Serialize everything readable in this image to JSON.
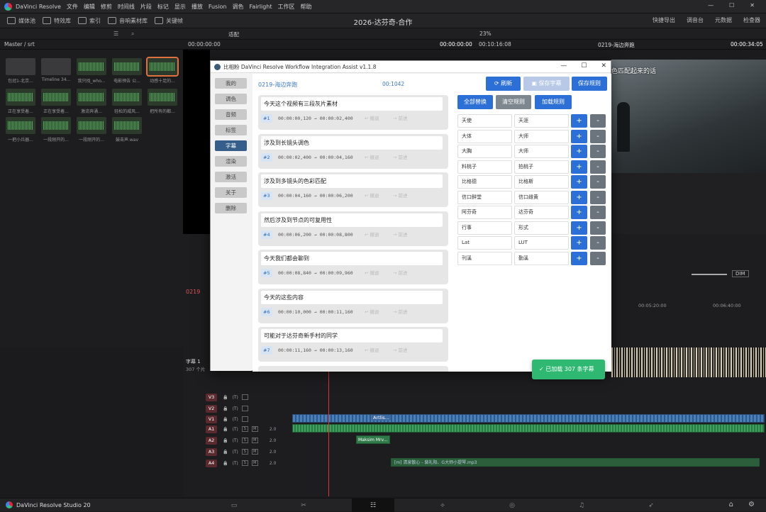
{
  "app": {
    "title": "DaVinci Resolve",
    "menu": [
      "文件",
      "编辑",
      "修剪",
      "时间线",
      "片段",
      "标记",
      "显示",
      "播放",
      "Fusion",
      "调色",
      "Fairlight",
      "工作区",
      "帮助"
    ]
  },
  "toolbar": {
    "media_pool": "媒体池",
    "effects": "特效库",
    "index": "索引",
    "sound_library": "音响素材库",
    "keyframes": "关键帧",
    "project_title": "2026-达芬奇-合作",
    "quick_export": "快捷导出",
    "mixer": "调音台",
    "metadata": "元数据",
    "inspector": "检查器"
  },
  "row3": {
    "fit": "适配",
    "zoom": "23%"
  },
  "row4": {
    "breadcrumb": "Master / srt",
    "tc_left": "00:00:00:00",
    "tc_mid": "00:00:00:00",
    "tc_right_a": "00:10:16:08",
    "timeline_name": "0219-海边奔跑",
    "tc_right_b": "00:00:34:05"
  },
  "mediapool": {
    "clips": [
      {
        "label": "包冠1-北京...",
        "type": "img"
      },
      {
        "label": "Timeline 34...",
        "type": "img"
      },
      {
        "label": "我只找_who...",
        "type": "wave"
      },
      {
        "label": "电影预告 公...",
        "type": "wave"
      },
      {
        "label": "动感十足的...",
        "type": "wave",
        "selected": true
      },
      {
        "label": "正在享受着...",
        "type": "wave"
      },
      {
        "label": "正在享受着...",
        "type": "wave"
      },
      {
        "label": "激流奔涌...",
        "type": "wave"
      },
      {
        "label": "轻松的威风...",
        "type": "wave"
      },
      {
        "label": "把所有的都...",
        "type": "wave"
      },
      {
        "label": "一把小兵器...",
        "type": "wave"
      },
      {
        "label": "一段刚开的...",
        "type": "wave"
      },
      {
        "label": "一段刚开的...",
        "type": "wave"
      },
      {
        "label": "鼓击声.wav",
        "type": "wave"
      }
    ]
  },
  "viewer": {
    "subtitle": "色匹配起来的话"
  },
  "plugin": {
    "title": "比相粉 DaVinci Resolve Workflow Integration Assist v1.1.8",
    "nav": [
      "我的",
      "调色",
      "音频",
      "标签",
      "字幕",
      "渲染",
      "激活",
      "关于",
      "删除"
    ],
    "active_nav": "字幕",
    "timeline_name": "0219-海边奔跑",
    "duration": "00:1042",
    "buttons": {
      "refresh": "刷新",
      "save_subtitle": "保存字幕",
      "save_rules": "保存规则",
      "replace_all": "全部替换",
      "clear_rules": "清空规则",
      "load_rules": "加载规则"
    },
    "subtitles": [
      {
        "text": "今天这个视频有三段灰片素材",
        "num": "#1",
        "time": "00:00:00,120 → 00:00:02,400",
        "act1": "↩ 撤退",
        "act2": "→ 前进"
      },
      {
        "text": "涉及到长镜头调色",
        "num": "#2",
        "time": "00:00:02,400 → 00:00:04,160",
        "act1": "↩ 撤退",
        "act2": "→ 前进"
      },
      {
        "text": "涉及到多镜头的色彩匹配",
        "num": "#3",
        "time": "00:00:04,160 → 00:00:06,200",
        "act1": "↩ 撤退",
        "act2": "→ 前进"
      },
      {
        "text": "然后涉及到节点的可复用性",
        "num": "#4",
        "time": "00:00:06,200 → 00:00:08,800",
        "act1": "↩ 撤退",
        "act2": "→ 前进"
      },
      {
        "text": "今天我们都会聊到",
        "num": "#5",
        "time": "00:00:08,840 → 00:00:09,960",
        "act1": "↩ 撤退",
        "act2": "→ 前进"
      },
      {
        "text": "今天的这些内容",
        "num": "#6",
        "time": "00:00:10,000 → 00:00:11,160",
        "act1": "↩ 撤退",
        "act2": "→ 前进"
      },
      {
        "text": "可能对于达芬奇新手村的同学",
        "num": "#7",
        "time": "00:00:11,160 → 00:00:13,160",
        "act1": "↩ 撤退",
        "act2": "→ 前进"
      }
    ],
    "rules": [
      {
        "from": "天使",
        "to": "天涯"
      },
      {
        "from": "大体",
        "to": "大师"
      },
      {
        "from": "大胸",
        "to": "大师"
      },
      {
        "from": "料桃子",
        "to": "拍桃子"
      },
      {
        "from": "比格德",
        "to": "比格斯"
      },
      {
        "from": "信口鲜堂",
        "to": "信口雌黄"
      },
      {
        "from": "阿芬奇",
        "to": "达芬奇"
      },
      {
        "from": "行事",
        "to": "形式"
      },
      {
        "from": "Lat",
        "to": "LUT"
      },
      {
        "from": "刊溪",
        "to": "勤溪"
      }
    ],
    "plus": "+",
    "minus": "-",
    "toast": "✓ 已加载 307 条字幕"
  },
  "timeline": {
    "timecode_mark": "0219",
    "ruler": [
      "00:05:20:00",
      "00:06:40:00"
    ],
    "subtitle_track": {
      "name": "字幕 1",
      "count": "307 个片"
    },
    "tracks": [
      {
        "label": "V3",
        "kind": "v"
      },
      {
        "label": "V2",
        "kind": "v"
      },
      {
        "label": "V1",
        "kind": "v"
      },
      {
        "label": "A1",
        "kind": "a",
        "level": "2.0"
      },
      {
        "label": "A2",
        "kind": "a",
        "level": "2.0"
      },
      {
        "label": "A3",
        "kind": "a",
        "level": "2.0"
      },
      {
        "label": "A4",
        "kind": "a",
        "level": "2.0"
      }
    ],
    "clip_v1": "Artlis...",
    "clip_a2": "Maksim Mrv...",
    "clip_a4": "[m] 清泉散心 - 裴礼阳、G大师小提琴.mp3",
    "dim": "DIM"
  },
  "bottom": {
    "brand": "DaVinci Resolve Studio 20"
  }
}
